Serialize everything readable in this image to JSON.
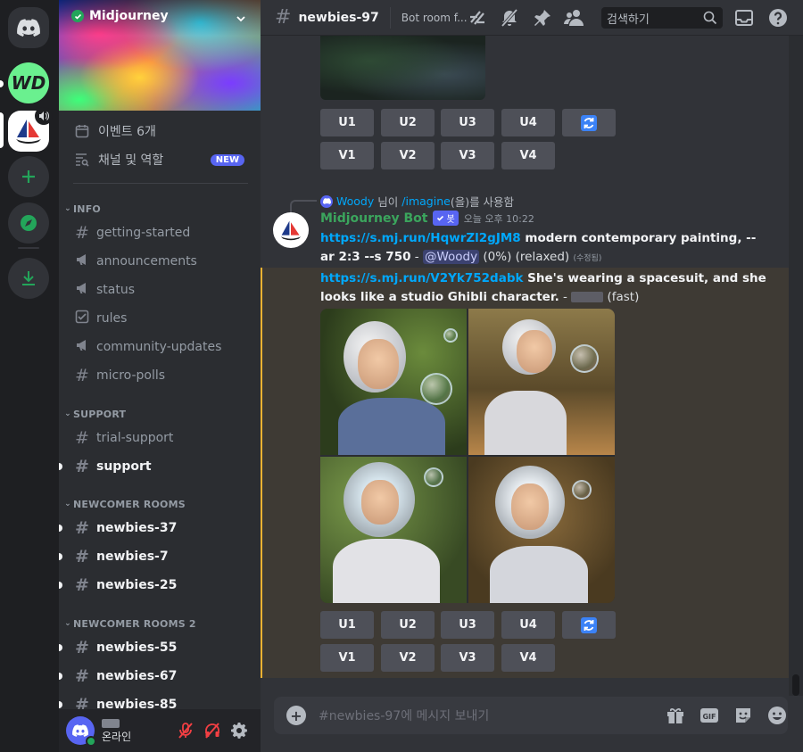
{
  "server": {
    "name": "Midjourney",
    "wd_label": "WD"
  },
  "sidebar": {
    "events_label": "이벤트 6개",
    "channels_roles_label": "채널 및 역할",
    "new_badge": "NEW",
    "categories": {
      "info": "INFO",
      "support": "SUPPORT",
      "newcomer": "NEWCOMER ROOMS",
      "newcomer2": "NEWCOMER ROOMS 2"
    },
    "channels": {
      "getting_started": "getting-started",
      "announcements": "announcements",
      "status": "status",
      "rules": "rules",
      "community_updates": "community-updates",
      "micro_polls": "micro-polls",
      "trial_support": "trial-support",
      "support": "support",
      "newbies_37": "newbies-37",
      "newbies_7": "newbies-7",
      "newbies_25": "newbies-25",
      "newbies_55": "newbies-55",
      "newbies_67": "newbies-67",
      "newbies_85": "newbies-85"
    }
  },
  "user": {
    "status": "온라인"
  },
  "header": {
    "channel": "newbies-97",
    "topic": "Bot room f...",
    "search_placeholder": "검색하기"
  },
  "messages": {
    "buttons": {
      "u1": "U1",
      "u2": "U2",
      "u3": "U3",
      "u4": "U4",
      "v1": "V1",
      "v2": "V2",
      "v3": "V3",
      "v4": "V4"
    },
    "reply": {
      "user": "Woody",
      "suffix1": " 님이 ",
      "command": "/imagine",
      "suffix2": "(을)를 사용함"
    },
    "bot": {
      "name": "Midjourney Bot",
      "tag": "봇",
      "time": "오늘 오후 10:22"
    },
    "first": {
      "link": "https://s.mj.run/HqwrZl2gJM8",
      "prompt": " modern contemporary painting, --ar 2:3 --s 750",
      "sep": " - ",
      "mention": "@Woody",
      "status": " (0%) (relaxed) ",
      "edited": "(수정됨)"
    },
    "second": {
      "link": "https://s.mj.run/V2Yk752dabk",
      "prompt": " She's wearing a spacesuit, and she looks like a studio Ghibli character.",
      "sep": " - ",
      "mode": " (fast)"
    }
  },
  "composer": {
    "placeholder": "#newbies-97에 메시지 보내기"
  },
  "colors": {
    "accent": "#5865f2",
    "online": "#23a55a",
    "link": "#00a8fc",
    "highlight_border": "#f0b232"
  }
}
